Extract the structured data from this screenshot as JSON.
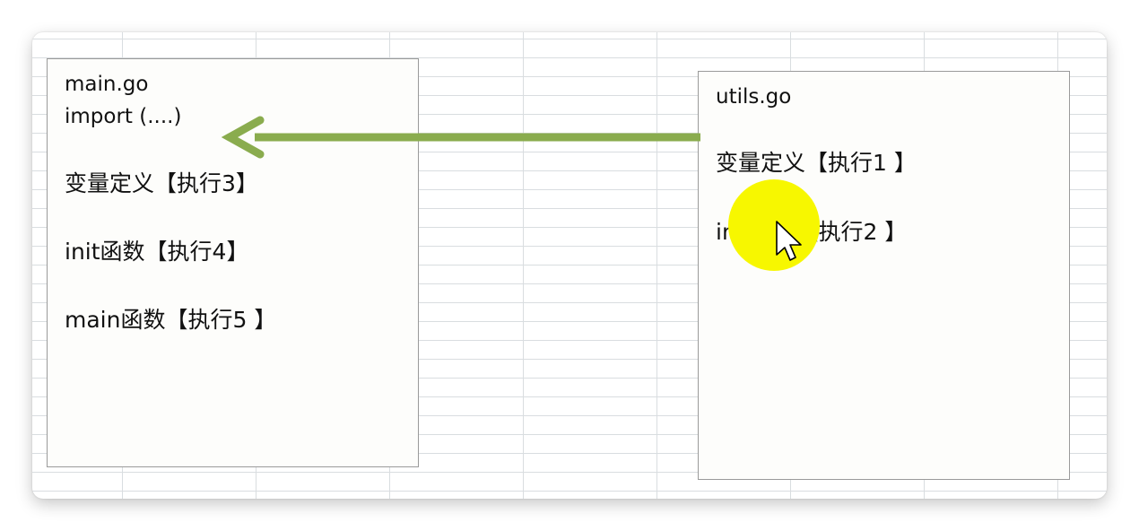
{
  "main_file": {
    "title": "main.go",
    "import_line": "import (....)",
    "lines": [
      "变量定义【执行3】",
      "init函数【执行4】",
      "main函数【执行5 】"
    ]
  },
  "utils_file": {
    "title": "utils.go",
    "lines": [
      "变量定义【执行1 】",
      "init函数【执行2 】"
    ]
  },
  "colors": {
    "arrow": "#8aac4e",
    "highlight": "#f7f700",
    "grid": "#d9dde0"
  },
  "icons": [
    "arrow-left",
    "mouse-cursor"
  ]
}
